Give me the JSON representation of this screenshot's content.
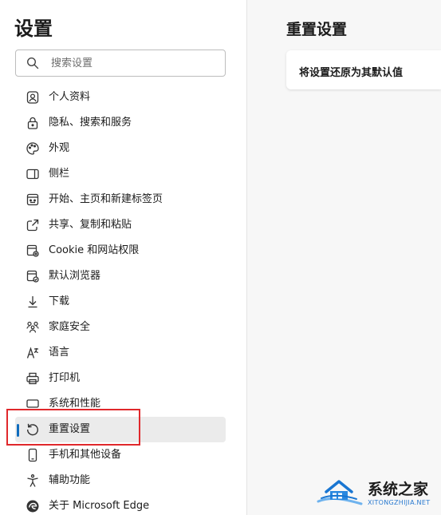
{
  "sidebar": {
    "title": "设置",
    "search": {
      "placeholder": "搜索设置",
      "value": ""
    },
    "items": [
      {
        "label": "个人资料",
        "icon": "profile-icon"
      },
      {
        "label": "隐私、搜索和服务",
        "icon": "lock-icon"
      },
      {
        "label": "外观",
        "icon": "palette-icon"
      },
      {
        "label": "侧栏",
        "icon": "sidebar-icon"
      },
      {
        "label": "开始、主页和新建标签页",
        "icon": "home-tab-icon"
      },
      {
        "label": "共享、复制和粘贴",
        "icon": "share-icon"
      },
      {
        "label": "Cookie 和网站权限",
        "icon": "cookie-permissions-icon"
      },
      {
        "label": "默认浏览器",
        "icon": "default-browser-icon"
      },
      {
        "label": "下载",
        "icon": "download-icon"
      },
      {
        "label": "家庭安全",
        "icon": "family-icon"
      },
      {
        "label": "语言",
        "icon": "language-icon"
      },
      {
        "label": "打印机",
        "icon": "printer-icon"
      },
      {
        "label": "系统和性能",
        "icon": "system-icon"
      },
      {
        "label": "重置设置",
        "icon": "reset-icon",
        "selected": true
      },
      {
        "label": "手机和其他设备",
        "icon": "phone-icon"
      },
      {
        "label": "辅助功能",
        "icon": "accessibility-icon"
      },
      {
        "label": "关于 Microsoft Edge",
        "icon": "edge-logo-icon"
      }
    ]
  },
  "main": {
    "title": "重置设置",
    "card_text": "将设置还原为其默认值"
  },
  "watermark": {
    "name": "系统之家",
    "url": "XITONGZHIJIA.NET"
  },
  "colors": {
    "accent": "#0f6cbd",
    "highlight_border": "#e0282c",
    "selected_bg": "#ebebeb",
    "page_bg": "#f7f7f7"
  }
}
